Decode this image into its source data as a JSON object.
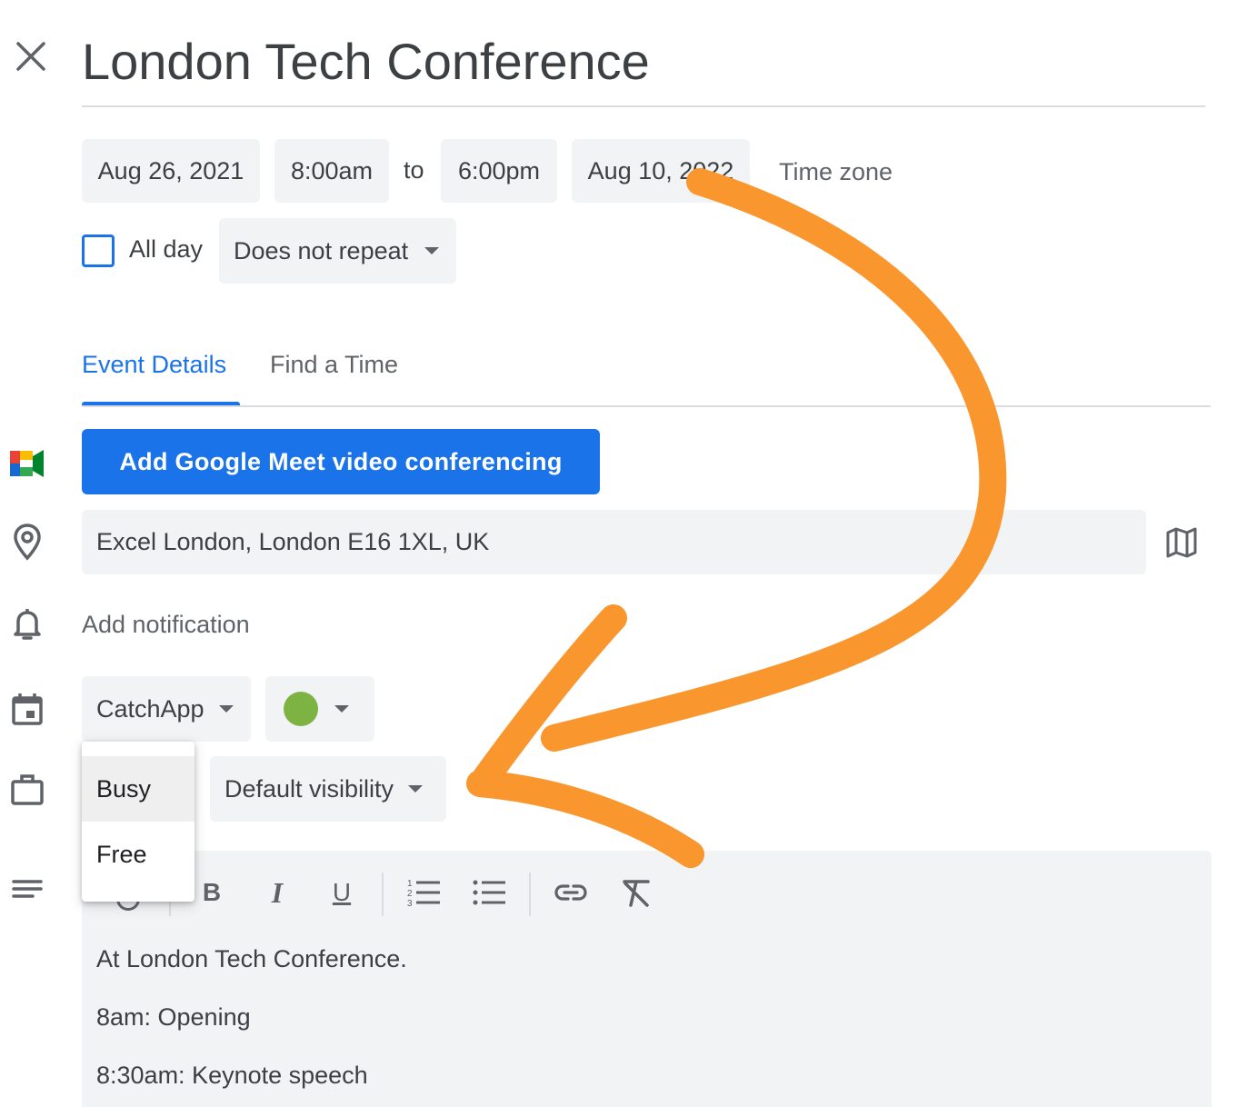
{
  "header": {
    "title": "London Tech Conference"
  },
  "datetime": {
    "start_date": "Aug 26, 2021",
    "start_time": "8:00am",
    "to_label": "to",
    "end_time": "6:00pm",
    "end_date": "Aug 10, 2022",
    "time_zone": "Time zone"
  },
  "options": {
    "all_day_label": "All day",
    "all_day_checked": false,
    "repeat": "Does not repeat"
  },
  "tabs": [
    {
      "label": "Event Details",
      "active": true
    },
    {
      "label": "Find a Time",
      "active": false
    }
  ],
  "meet_button": "Add Google Meet video conferencing",
  "location": {
    "value": "Excel London, London E16 1XL, UK"
  },
  "notification": "Add notification",
  "calendar": {
    "name": "CatchApp",
    "color": "#7cb342"
  },
  "availability": {
    "options": [
      "Busy",
      "Free"
    ],
    "highlighted": "Busy"
  },
  "visibility": "Default visibility",
  "description": {
    "lines": [
      "At London Tech Conference.",
      "8am: Opening",
      "8:30am: Keynote speech"
    ]
  },
  "colors": {
    "accent": "#1a73e8",
    "annotation_arrow": "#fa962e",
    "field_bg": "#f1f3f4"
  },
  "icons": [
    "close-icon",
    "google-meet-icon",
    "location-pin-icon",
    "map-icon",
    "bell-icon",
    "calendar-icon",
    "briefcase-icon",
    "description-icon",
    "bold-icon",
    "italic-icon",
    "underline-icon",
    "numbered-list-icon",
    "bulleted-list-icon",
    "link-icon",
    "clear-formatting-icon"
  ]
}
